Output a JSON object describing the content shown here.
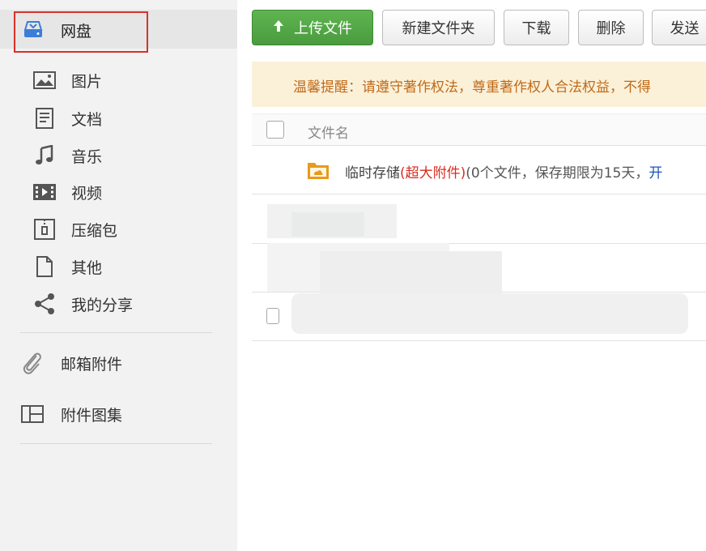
{
  "sidebar": {
    "disk_label": "网盘",
    "categories": [
      {
        "label": "图片",
        "icon": "image-icon"
      },
      {
        "label": "文档",
        "icon": "document-icon"
      },
      {
        "label": "音乐",
        "icon": "music-note-icon"
      },
      {
        "label": "视频",
        "icon": "video-icon"
      },
      {
        "label": "压缩包",
        "icon": "archive-icon"
      },
      {
        "label": "其他",
        "icon": "file-icon"
      },
      {
        "label": "我的分享",
        "icon": "share-icon"
      }
    ],
    "attachments_label": "邮箱附件",
    "gallery_label": "附件图集"
  },
  "toolbar": {
    "upload_label": "上传文件",
    "new_folder_label": "新建文件夹",
    "download_label": "下载",
    "delete_label": "删除",
    "send_label": "发送"
  },
  "notice": {
    "text": "温馨提醒：请遵守著作权法，尊重著作权人合法权益，不得"
  },
  "table": {
    "header_name": "文件名",
    "rows": [
      {
        "name": "临时存储",
        "tag": "(超大附件)",
        "info": "(0个文件，保存期限为15天，",
        "link": "开"
      }
    ]
  },
  "colors": {
    "upload_button": "#4a9c3e",
    "notice_bg": "#fbf1d9",
    "notice_text": "#c06a18",
    "highlight_border": "#d9302c",
    "tag_red": "#d62e22",
    "link_blue": "#1c55b5"
  }
}
